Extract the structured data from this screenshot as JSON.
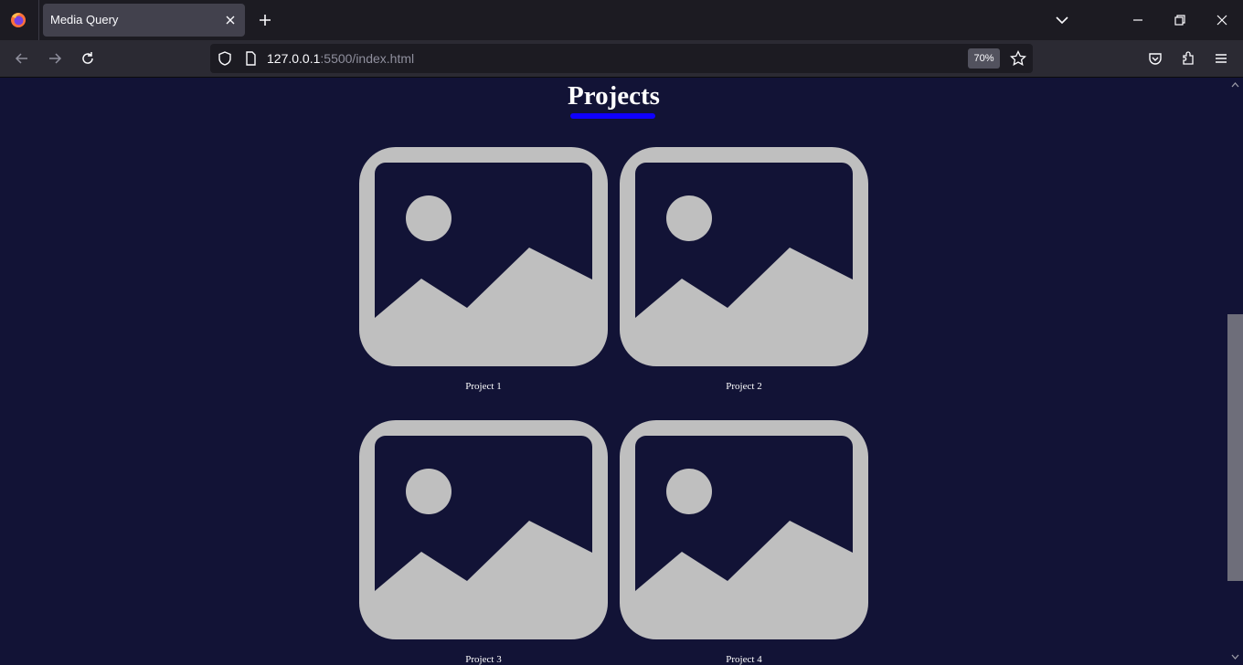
{
  "browser": {
    "tab_title": "Media Query",
    "url_host": "127.0.0.1",
    "url_rest": ":5500/index.html",
    "zoom": "70%"
  },
  "page": {
    "section_title": "Projects",
    "projects": [
      {
        "label": "Project 1"
      },
      {
        "label": "Project 2"
      },
      {
        "label": "Project 3"
      },
      {
        "label": "Project 4"
      }
    ]
  },
  "colors": {
    "page_background": "#121336",
    "title_underline": "#0f00ff",
    "image_placeholder": "#bfbfbf"
  },
  "icons": {
    "project_card": "image-placeholder-icon"
  }
}
